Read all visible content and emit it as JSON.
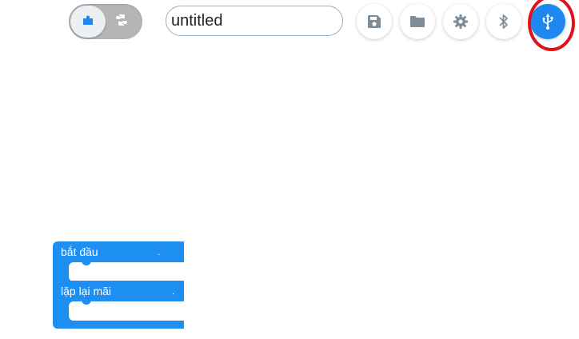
{
  "toolbar": {
    "mode_toggle": {
      "active_icon": "puzzle-piece-icon",
      "inactive_icon": "python-icon",
      "active_color": "#1e88f0",
      "inactive_color": "#ffffff"
    },
    "project_name": {
      "value": "untitled"
    },
    "buttons": [
      {
        "name": "save",
        "icon": "floppy-disk-icon"
      },
      {
        "name": "open",
        "icon": "folder-icon"
      },
      {
        "name": "settings",
        "icon": "gear-icon"
      },
      {
        "name": "bluetooth",
        "icon": "bluetooth-icon"
      },
      {
        "name": "usb",
        "icon": "usb-icon",
        "active": true
      }
    ],
    "icon_color": "#7f8c99",
    "accent": "#1e88f0",
    "highlight_color": "#e0111a"
  },
  "blocks": {
    "color": "#1e8ff2",
    "start_label": "bắt đầu",
    "loop_label": "lặp lại mãi",
    "dot": "."
  }
}
